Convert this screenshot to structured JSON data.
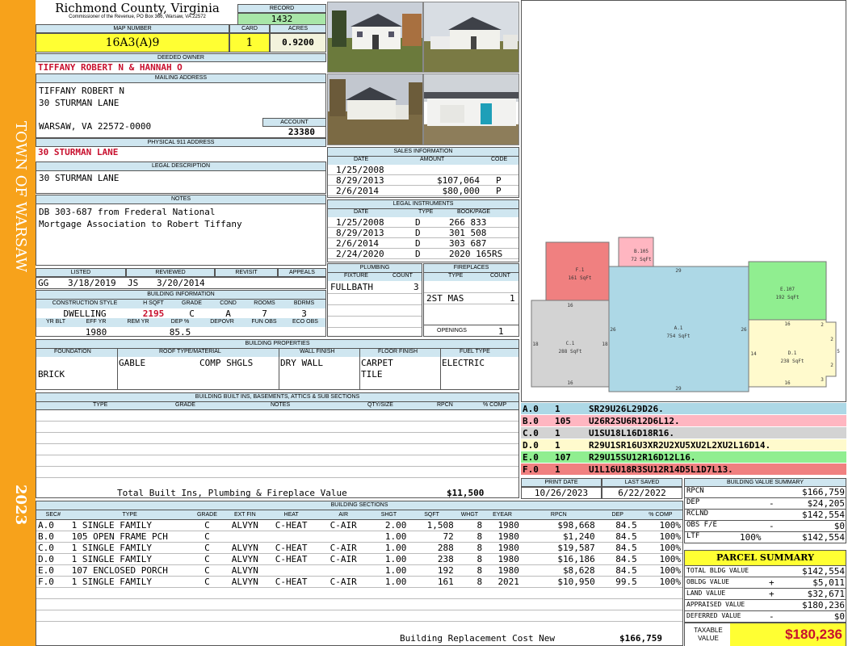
{
  "sidebar": {
    "town": "TOWN OF WARSAW",
    "year": "2023"
  },
  "header": {
    "county": "Richmond County, Virginia",
    "subtitle": "Commissioner of the Revenue, PO Box 366, Warsaw, VA 22572",
    "record_label": "RECORD",
    "record": "1432",
    "map_label": "MAP NUMBER",
    "map": "16A3(A)9",
    "card_label": "CARD",
    "card": "1",
    "acres_label": "ACRES",
    "acres": "0.9200"
  },
  "owner": {
    "label": "DEEDED OWNER",
    "value": "TIFFANY ROBERT N & HANNAH O"
  },
  "mailing": {
    "label": "MAILING ADDRESS",
    "line1": "TIFFANY ROBERT N",
    "line2": "30 STURMAN LANE",
    "line3": "WARSAW, VA 22572-0000",
    "account_label": "ACCOUNT",
    "account": "23380"
  },
  "physical": {
    "label": "PHYSICAL 911 ADDRESS",
    "value": "30 STURMAN LANE"
  },
  "legal": {
    "label": "LEGAL DESCRIPTION",
    "value": "30 STURMAN LANE"
  },
  "notes": {
    "label": "NOTES",
    "line1": "DB 303-687 from Frederal National",
    "line2": "Mortgage Association to Robert Tiffany"
  },
  "listed": {
    "listed_label": "LISTED",
    "reviewed_label": "REVIEWED",
    "revisit_label": "REVISIT",
    "appeals_label": "APPEALS",
    "listed_by": "GG",
    "listed_date": "3/18/2019",
    "reviewed_by": "JS",
    "reviewed_date": "3/20/2014"
  },
  "building_info": {
    "label": "BUILDING INFORMATION",
    "h": [
      "CONSTRUCTION STYLE",
      "H SQFT",
      "GRADE",
      "COND",
      "ROOMS",
      "BDRMS"
    ],
    "v": [
      "DWELLING",
      "2195",
      "C",
      "A",
      "7",
      "3"
    ],
    "h2": [
      "YR BLT",
      "EFF YR",
      "REM YR",
      "DEP %",
      "DEPOVR",
      "FUN OBS",
      "ECO OBS"
    ],
    "v2": [
      "",
      "1980",
      "",
      "85.5",
      "",
      "",
      ""
    ]
  },
  "sales": {
    "label": "SALES INFORMATION",
    "cols": [
      "DATE",
      "AMOUNT",
      "CODE"
    ],
    "rows": [
      [
        "1/25/2008",
        "",
        ""
      ],
      [
        "8/29/2013",
        "$107,064",
        "P"
      ],
      [
        "2/6/2014",
        "$80,000",
        "P"
      ]
    ]
  },
  "instruments": {
    "label": "LEGAL INSTRUMENTS",
    "cols": [
      "DATE",
      "TYPE",
      "BOOK/PAGE"
    ],
    "rows": [
      [
        "1/25/2008",
        "D",
        "266 833"
      ],
      [
        "8/29/2013",
        "D",
        "301 508"
      ],
      [
        "2/6/2014",
        "D",
        "303 687"
      ],
      [
        "2/24/2020",
        "D",
        "2020 165RS"
      ]
    ]
  },
  "plumbing": {
    "label": "PLUMBING",
    "fixture_label": "FIXTURE",
    "count_label": "COUNT",
    "fixture": "FULLBATH",
    "count": "3"
  },
  "fireplaces": {
    "label": "FIREPLACES",
    "type_label": "TYPE",
    "count_label": "COUNT",
    "type": "2ST MAS",
    "count": "1",
    "openings_label": "OPENINGS",
    "openings": "1"
  },
  "properties": {
    "label": "BUILDING PROPERTIES",
    "h": [
      "FOUNDATION",
      "ROOF TYPE/MATERIAL",
      "WALL FINISH",
      "FLOOR FINISH",
      "FUEL TYPE"
    ],
    "foundation": "BRICK",
    "roof_type": "GABLE",
    "roof_material": "COMP SHGLS",
    "wall": "DRY WALL",
    "floor1": "CARPET",
    "floor2": "TILE",
    "fuel": "ELECTRIC"
  },
  "builtins": {
    "label": "BUILDING BUILT INS, BASEMENTS, ATTICS & SUB SECTIONS",
    "cols": [
      "TYPE",
      "GRADE",
      "NOTES",
      "QTY/SIZE",
      "RPCN",
      "% COMP"
    ],
    "total_label": "Total Built Ins, Plumbing & Fireplace Value",
    "total": "$11,500"
  },
  "dates": {
    "print_label": "PRINT DATE",
    "print": "10/26/2023",
    "saved_label": "LAST SAVED",
    "saved": "6/22/2022"
  },
  "sketch": {
    "areas": [
      {
        "id": "F.1",
        "sqft": "161 SqFt",
        "color": "#f08080"
      },
      {
        "id": "B.105",
        "sqft": "72 SqFt",
        "color": "#ffb6c1"
      },
      {
        "id": "A.1",
        "sqft": "754 SqFt",
        "color": "#add8e6"
      },
      {
        "id": "E.107",
        "sqft": "192 SqFt",
        "color": "#90ee90"
      },
      {
        "id": "C.1",
        "sqft": "288 SqFt",
        "color": "#d3d3d3"
      },
      {
        "id": "D.1",
        "sqft": "238 SqFt",
        "color": "#fffacd"
      }
    ],
    "dims": [
      "29",
      "16",
      "26",
      "26",
      "18",
      "18",
      "16",
      "29",
      "16",
      "16",
      "14",
      "2",
      "2",
      "5",
      "2",
      "3"
    ]
  },
  "sections_codes": [
    {
      "sec": "A.0",
      "n": "1",
      "code": "SR29U26L29D26.",
      "color": "#add8e6"
    },
    {
      "sec": "B.0",
      "n": "105",
      "code": "U26R2SU6R12D6L12.",
      "color": "#ffb6c1"
    },
    {
      "sec": "C.0",
      "n": "1",
      "code": "U1SU18L16D18R16.",
      "color": "#d3d3d3"
    },
    {
      "sec": "D.0",
      "n": "1",
      "code": "R29U1SR16U3XR2U2XU5XU2L2XU2L16D14.",
      "color": "#fffacd"
    },
    {
      "sec": "E.0",
      "n": "107",
      "code": "R29U15SU12R16D12L16.",
      "color": "#90ee90"
    },
    {
      "sec": "F.0",
      "n": "1",
      "code": "U1L16U18R3SU12R14D5L1D7L13.",
      "color": "#f08080"
    }
  ],
  "building_sections": {
    "label": "BUILDING SECTIONS",
    "cols": [
      "SEC#",
      "TYPE",
      "GRADE",
      "EXT FIN",
      "HEAT",
      "AIR",
      "SHGT",
      "SQFT",
      "WHGT",
      "EYEAR",
      "RPCN",
      "DEP",
      "% COMP"
    ],
    "rows": [
      [
        "A.0",
        "1 SINGLE FAMILY",
        "C",
        "ALVYN",
        "C-HEAT",
        "C-AIR",
        "2.00",
        "1,508",
        "8",
        "1980",
        "$98,668",
        "84.5",
        "100%"
      ],
      [
        "B.0",
        "105 OPEN FRAME PCH",
        "C",
        "",
        "",
        "",
        "1.00",
        "72",
        "8",
        "1980",
        "$1,240",
        "84.5",
        "100%"
      ],
      [
        "C.0",
        "1 SINGLE FAMILY",
        "C",
        "ALVYN",
        "C-HEAT",
        "C-AIR",
        "1.00",
        "288",
        "8",
        "1980",
        "$19,587",
        "84.5",
        "100%"
      ],
      [
        "D.0",
        "1 SINGLE FAMILY",
        "C",
        "ALVYN",
        "C-HEAT",
        "C-AIR",
        "1.00",
        "238",
        "8",
        "1980",
        "$16,186",
        "84.5",
        "100%"
      ],
      [
        "E.0",
        "107 ENCLOSED PORCH",
        "C",
        "ALVYN",
        "",
        "",
        "1.00",
        "192",
        "8",
        "1980",
        "$8,628",
        "84.5",
        "100%"
      ],
      [
        "F.0",
        "1 SINGLE FAMILY",
        "C",
        "ALVYN",
        "C-HEAT",
        "C-AIR",
        "1.00",
        "161",
        "8",
        "2021",
        "$10,950",
        "99.5",
        "100%"
      ]
    ],
    "total_label": "Building Replacement Cost New",
    "total": "$166,759"
  },
  "value_summary": {
    "label": "BUILDING VALUE SUMMARY",
    "rows": [
      {
        "k": "RPCN",
        "pct": "",
        "sign": "",
        "v": "$166,759"
      },
      {
        "k": "DEP",
        "pct": "",
        "sign": "-",
        "v": "$24,205"
      },
      {
        "k": "RCLND",
        "pct": "",
        "sign": "",
        "v": "$142,554"
      },
      {
        "k": "OBS F/E",
        "pct": "",
        "sign": "-",
        "v": "$0"
      },
      {
        "k": "LTF",
        "pct": "100%",
        "sign": "",
        "v": "$142,554"
      }
    ]
  },
  "parcel": {
    "label": "PARCEL SUMMARY",
    "rows": [
      {
        "k": "TOTAL BLDG VALUE",
        "sign": "",
        "v": "$142,554"
      },
      {
        "k": "OBLDG VALUE",
        "sign": "+",
        "v": "$5,011"
      },
      {
        "k": "LAND VALUE",
        "sign": "+",
        "v": "$32,671"
      },
      {
        "k": "APPRAISED VALUE",
        "sign": "",
        "v": "$180,236"
      },
      {
        "k": "DEFERRED VALUE",
        "sign": "-",
        "v": "$0"
      }
    ],
    "taxable_label": "TAXABLE VALUE",
    "taxable": "$180,236"
  }
}
